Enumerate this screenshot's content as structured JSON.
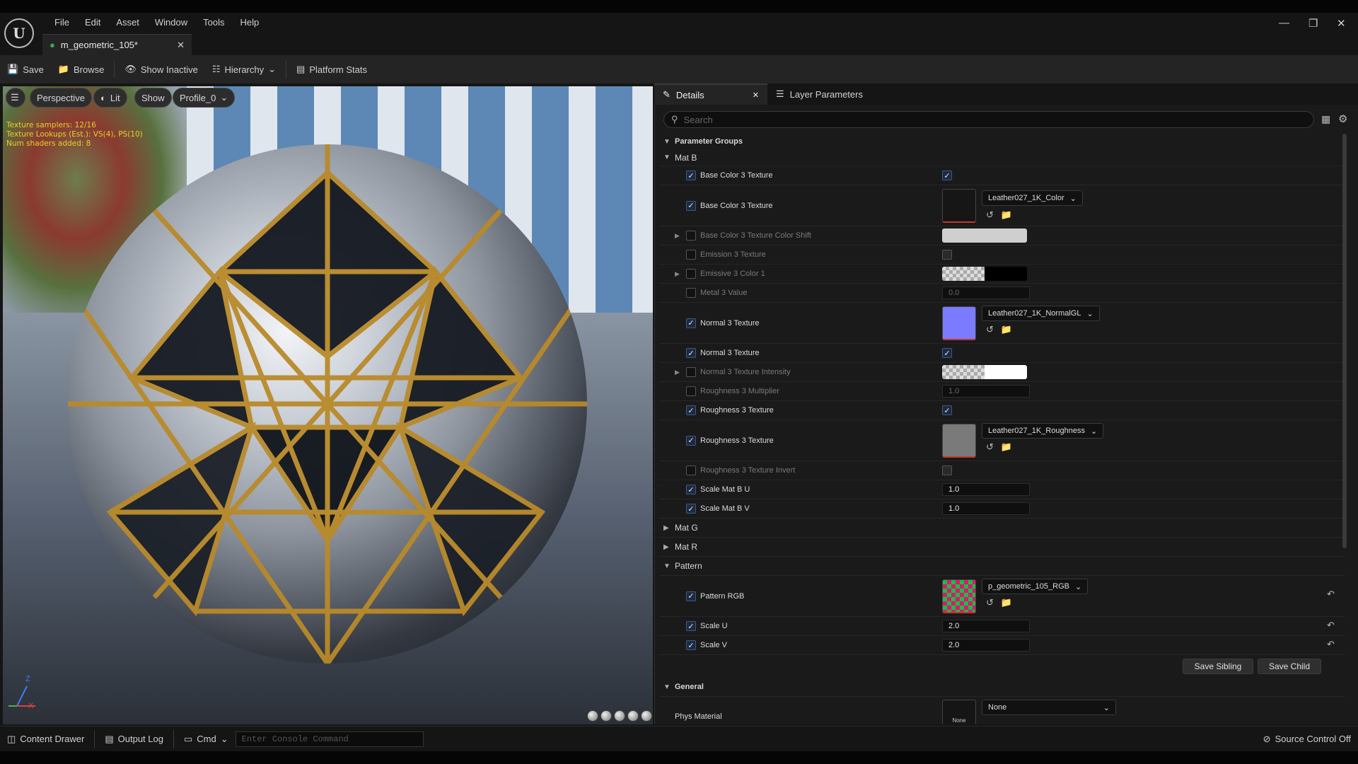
{
  "app": {
    "menu": [
      "File",
      "Edit",
      "Asset",
      "Window",
      "Tools",
      "Help"
    ],
    "tab_title": "m_geometric_105*",
    "logo_text": "U"
  },
  "toolbar": {
    "save": "Save",
    "browse": "Browse",
    "show_inactive": "Show Inactive",
    "hierarchy": "Hierarchy",
    "platform_stats": "Platform Stats"
  },
  "viewport": {
    "perspective": "Perspective",
    "lit": "Lit",
    "show": "Show",
    "profile": "Profile_0",
    "stats": [
      "Texture samplers: 12/16",
      "Texture Lookups (Est.): VS(4), PS(10)",
      "Num shaders added: 8"
    ],
    "axis_z": "Z",
    "axis_x": "X"
  },
  "panel": {
    "tab_details": "Details",
    "tab_layer": "Layer Parameters",
    "search_placeholder": "Search",
    "param_groups": "Parameter Groups",
    "mat_b": "Mat B",
    "mat_g": "Mat G",
    "mat_r": "Mat R",
    "pattern": "Pattern",
    "general": "General",
    "rows": [
      {
        "label": "Base Color 3 Texture",
        "enabled": true
      },
      {
        "label": "Base Color 3 Texture",
        "enabled": true,
        "asset": "Leather027_1K_Color"
      },
      {
        "label": "Base Color 3 Texture Color Shift",
        "enabled": false
      },
      {
        "label": "Emission 3 Texture",
        "enabled": false
      },
      {
        "label": "Emissive 3 Color 1",
        "enabled": false
      },
      {
        "label": "Metal 3 Value",
        "enabled": false,
        "value": "0.0"
      },
      {
        "label": "Normal 3 Texture",
        "enabled": true,
        "asset": "Leather027_1K_NormalGL"
      },
      {
        "label": "Normal 3 Texture",
        "enabled": true
      },
      {
        "label": "Normal 3 Texture Intensity",
        "enabled": false
      },
      {
        "label": "Roughness 3 Multiplier",
        "enabled": false,
        "value": "1.0"
      },
      {
        "label": "Roughness 3 Texture",
        "enabled": true
      },
      {
        "label": "Roughness 3 Texture",
        "enabled": true,
        "asset": "Leather027_1K_Roughness"
      },
      {
        "label": "Roughness 3 Texture Invert",
        "enabled": false
      },
      {
        "label": "Scale Mat B U",
        "enabled": true,
        "value": "1.0"
      },
      {
        "label": "Scale Mat B V",
        "enabled": true,
        "value": "1.0"
      }
    ],
    "pattern_rows": [
      {
        "label": "Pattern RGB",
        "asset": "p_geometric_105_RGB"
      },
      {
        "label": "Scale U",
        "value": "2.0"
      },
      {
        "label": "Scale V",
        "value": "2.0"
      }
    ],
    "save_sibling": "Save Sibling",
    "save_child": "Save Child",
    "phys_material": "Phys Material",
    "phys_value": "None",
    "phys_thumb": "None"
  },
  "status": {
    "content_drawer": "Content Drawer",
    "output_log": "Output Log",
    "cmd": "Cmd",
    "console_placeholder": "Enter Console Command",
    "source_control": "Source Control Off"
  },
  "colors": {
    "accent": "#3b5a8a",
    "warning_text": "#e6d227",
    "normal_swatch": "#7b7bff"
  }
}
